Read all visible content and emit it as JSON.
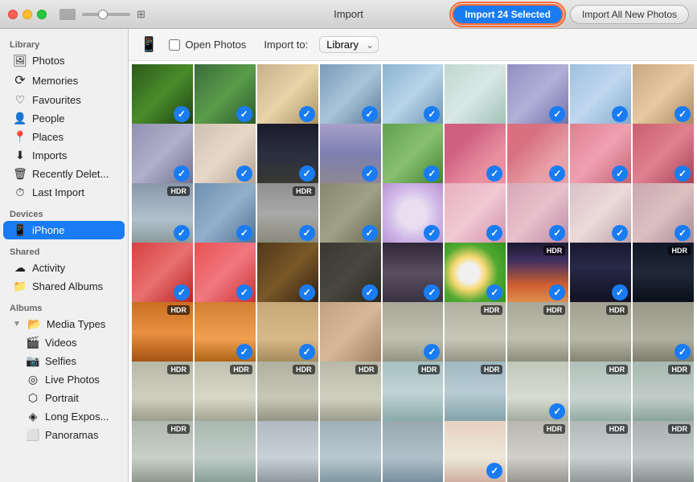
{
  "titlebar": {
    "title": "Import",
    "btn_import_selected": "Import 24 Selected",
    "btn_import_all": "Import All New Photos"
  },
  "toolbar": {
    "open_photos_label": "Open Photos",
    "import_to_label": "Import to:",
    "library_option": "Library",
    "device_icon": "📱"
  },
  "sidebar": {
    "library_header": "Library",
    "library_items": [
      {
        "id": "photos",
        "label": "Photos",
        "icon": "🖼"
      },
      {
        "id": "memories",
        "label": "Memories",
        "icon": "⟳"
      },
      {
        "id": "favourites",
        "label": "Favourites",
        "icon": "♡"
      },
      {
        "id": "people",
        "label": "People",
        "icon": "👤"
      },
      {
        "id": "places",
        "label": "Places",
        "icon": "📍"
      },
      {
        "id": "imports",
        "label": "Imports",
        "icon": "⬇"
      },
      {
        "id": "recently-deleted",
        "label": "Recently Delet...",
        "icon": "🗑"
      },
      {
        "id": "last-import",
        "label": "Last Import",
        "icon": "⏱"
      }
    ],
    "devices_header": "Devices",
    "devices_items": [
      {
        "id": "iphone",
        "label": "iPhone",
        "icon": "📱"
      }
    ],
    "shared_header": "Shared",
    "shared_items": [
      {
        "id": "activity",
        "label": "Activity",
        "icon": "☁"
      },
      {
        "id": "shared-albums",
        "label": "Shared Albums",
        "icon": "📁"
      }
    ],
    "albums_header": "Albums",
    "albums_items": [
      {
        "id": "media-types",
        "label": "Media Types",
        "icon": "📂"
      },
      {
        "id": "videos",
        "label": "Videos",
        "icon": "🎬"
      },
      {
        "id": "selfies",
        "label": "Selfies",
        "icon": "📷"
      },
      {
        "id": "live-photos",
        "label": "Live Photos",
        "icon": "◎"
      },
      {
        "id": "portrait",
        "label": "Portrait",
        "icon": "⬡"
      },
      {
        "id": "long-exposure",
        "label": "Long Expos...",
        "icon": "◈"
      },
      {
        "id": "panoramas",
        "label": "Panoramas",
        "icon": "⬜"
      }
    ]
  },
  "grid": {
    "check_icon": "✓",
    "hdr_label": "HDR"
  }
}
